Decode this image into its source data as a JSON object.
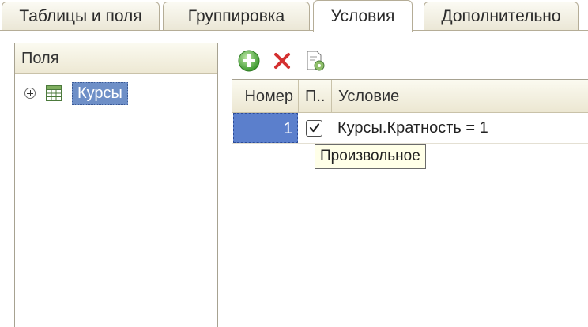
{
  "tabs": [
    {
      "label": "Таблицы и поля",
      "active": false
    },
    {
      "label": "Группировка",
      "active": false
    },
    {
      "label": "Условия",
      "active": true
    },
    {
      "label": "Дополнительно",
      "active": false
    }
  ],
  "fields_panel": {
    "header": "Поля",
    "tree": [
      {
        "label": "Курсы",
        "icon": "table-icon",
        "expandable": true,
        "selected": true
      }
    ]
  },
  "toolbar": {
    "buttons": [
      {
        "name": "add",
        "icon": "plus-circle-icon",
        "color": "#3c9a2e"
      },
      {
        "name": "delete",
        "icon": "red-x-icon",
        "color": "#d43030"
      },
      {
        "name": "edit-condition",
        "icon": "document-gear-icon",
        "color": "#4a7a3a"
      }
    ]
  },
  "conditions_grid": {
    "columns": [
      "Номер",
      "П..",
      "Условие"
    ],
    "rows": [
      {
        "number": "1",
        "checked": true,
        "condition": "Курсы.Кратность = 1"
      }
    ],
    "tooltip": "Произвольное"
  },
  "colors": {
    "selection": "#5b7fcc",
    "tree_selection": "#6e8fc7",
    "header_bg": "#ede8d3",
    "border": "#a7a291"
  }
}
